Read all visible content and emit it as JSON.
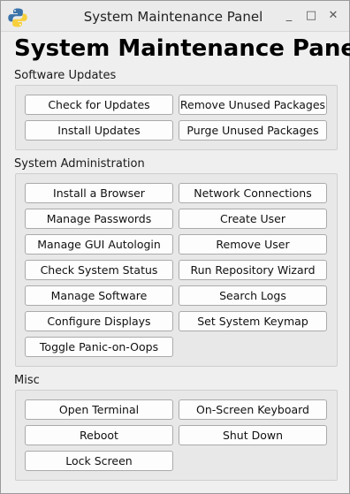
{
  "window": {
    "title": "System Maintenance Panel",
    "minimize_glyph": "_",
    "maximize_glyph": "□",
    "close_glyph": "✕"
  },
  "heading": "System Maintenance Panel",
  "sections": {
    "software_updates": {
      "label": "Software Updates",
      "buttons": [
        "Check for Updates",
        "Remove Unused Packages",
        "Install Updates",
        "Purge Unused Packages"
      ]
    },
    "system_administration": {
      "label": "System Administration",
      "buttons": [
        "Install a Browser",
        "Network Connections",
        "Manage Passwords",
        "Create User",
        "Manage GUI Autologin",
        "Remove User",
        "Check System Status",
        "Run Repository Wizard",
        "Manage Software",
        "Search Logs",
        "Configure Displays",
        "Set System Keymap",
        "Toggle Panic-on-Oops"
      ]
    },
    "misc": {
      "label": "Misc",
      "buttons": [
        "Open Terminal",
        "On-Screen Keyboard",
        "Reboot",
        "Shut Down",
        "Lock Screen"
      ]
    }
  },
  "colors": {
    "python_blue": "#3b73a8",
    "python_yellow": "#f7cf3b"
  }
}
